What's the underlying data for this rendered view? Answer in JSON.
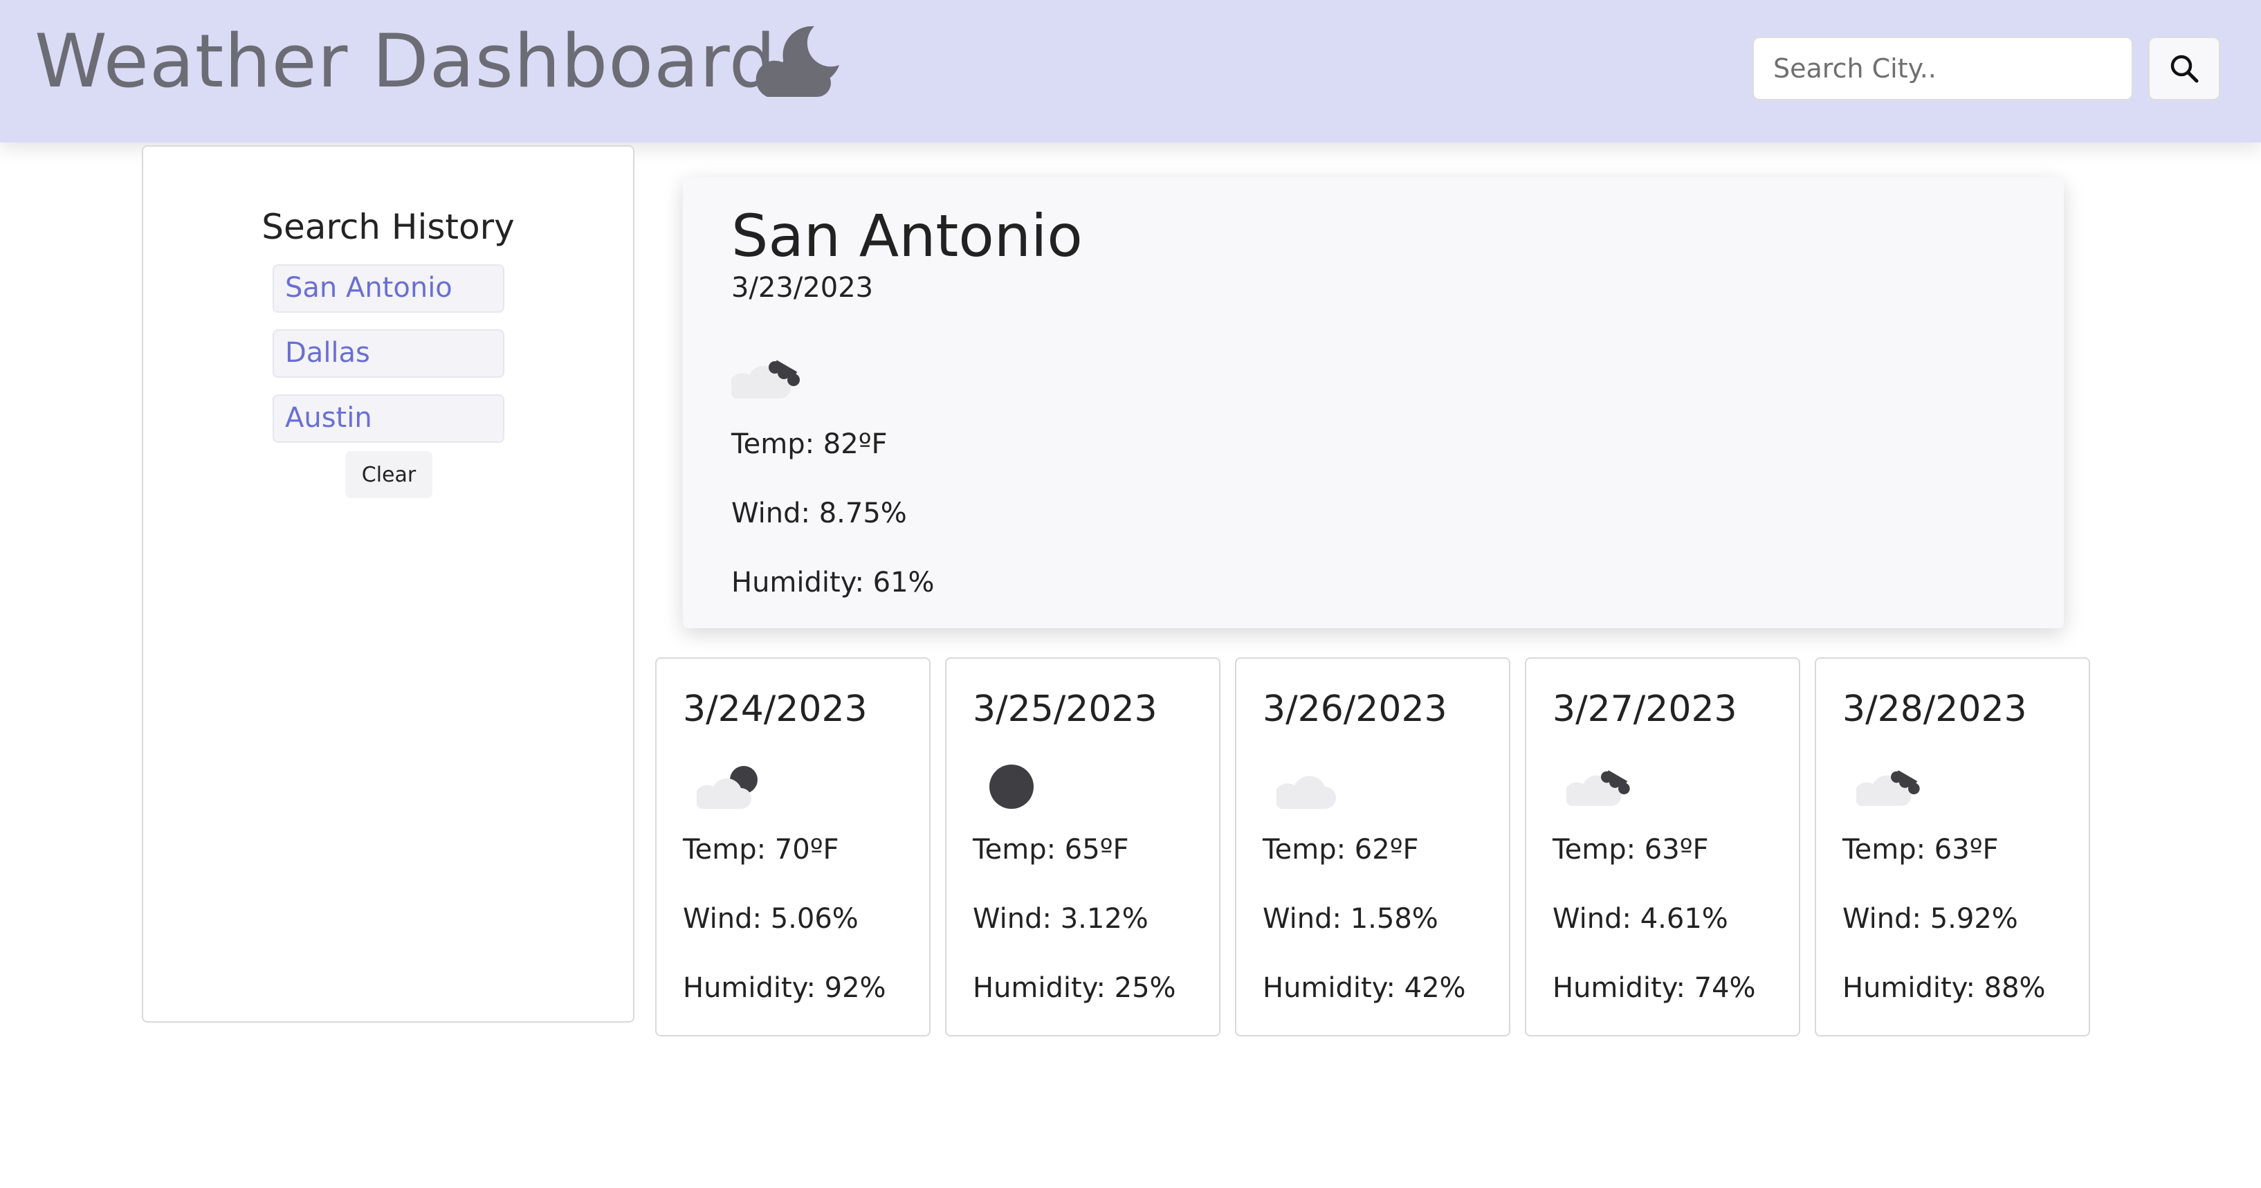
{
  "header": {
    "title": "Weather Dashboard",
    "title_icon": "cloud-moon-icon",
    "search": {
      "placeholder": "Search City..",
      "value": ""
    },
    "search_icon": "search-icon"
  },
  "sidebar": {
    "title": "Search History",
    "items": [
      {
        "label": "San Antonio"
      },
      {
        "label": "Dallas"
      },
      {
        "label": "Austin"
      }
    ],
    "clear_label": "Clear"
  },
  "current": {
    "city": "San Antonio",
    "date": "3/23/2023",
    "icon": "cloud-broken-icon",
    "temp": "Temp: 82ºF",
    "wind": "Wind: 8.75%",
    "humidity": "Humidity: 61%"
  },
  "forecast": [
    {
      "date": "3/24/2023",
      "icon": "cloud-partial-icon",
      "temp": "Temp: 70ºF",
      "wind": "Wind: 5.06%",
      "humidity": "Humidity: 92%"
    },
    {
      "date": "3/25/2023",
      "icon": "clear-night-icon",
      "temp": "Temp: 65ºF",
      "wind": "Wind: 3.12%",
      "humidity": "Humidity: 25%"
    },
    {
      "date": "3/26/2023",
      "icon": "cloud-icon",
      "temp": "Temp: 62ºF",
      "wind": "Wind: 1.58%",
      "humidity": "Humidity: 42%"
    },
    {
      "date": "3/27/2023",
      "icon": "cloud-broken-icon",
      "temp": "Temp: 63ºF",
      "wind": "Wind: 4.61%",
      "humidity": "Humidity: 74%"
    },
    {
      "date": "3/28/2023",
      "icon": "cloud-broken-icon",
      "temp": "Temp: 63ºF",
      "wind": "Wind: 5.92%",
      "humidity": "Humidity: 88%"
    }
  ],
  "colors": {
    "header_bg": "#dadcf6",
    "title_text": "#6c6c75",
    "link": "#6a6fd3",
    "icon_dark": "#3f3f43",
    "cloud_light": "#ececef"
  }
}
